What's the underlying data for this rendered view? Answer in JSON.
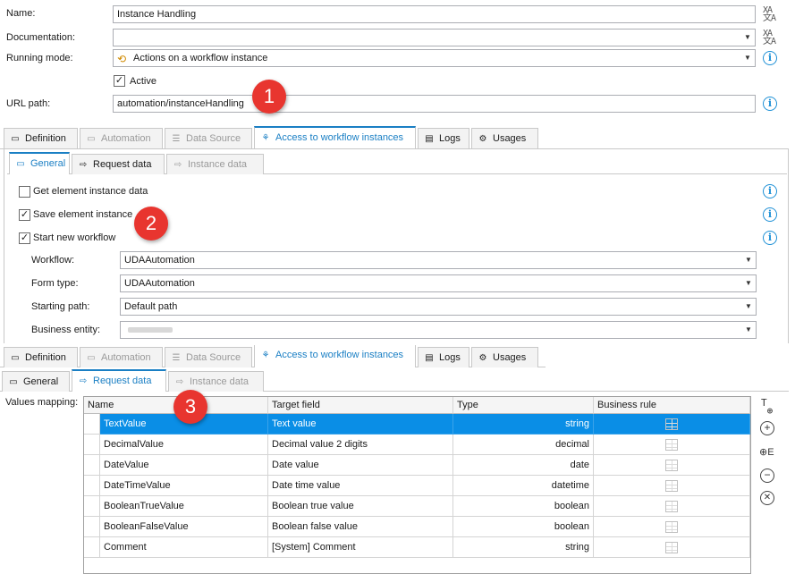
{
  "form": {
    "name_label": "Name:",
    "name_value": "Instance Handling",
    "documentation_label": "Documentation:",
    "documentation_value": "",
    "running_mode_label": "Running mode:",
    "running_mode_value": "Actions on a workflow instance",
    "active_label": "Active",
    "active_checked": true,
    "url_label": "URL path:",
    "url_value": "automation/instanceHandling"
  },
  "badges": [
    "1",
    "2",
    "3"
  ],
  "main_tabs": [
    {
      "label": "Definition",
      "icon": "window-icon",
      "state": "normal"
    },
    {
      "label": "Automation",
      "icon": "automation-icon",
      "state": "disabled"
    },
    {
      "label": "Data Source",
      "icon": "database-icon",
      "state": "disabled"
    },
    {
      "label": "Access to workflow instances",
      "icon": "workflow-icon",
      "state": "active"
    },
    {
      "label": "Logs",
      "icon": "logs-icon",
      "state": "normal"
    },
    {
      "label": "Usages",
      "icon": "usages-icon",
      "state": "normal"
    }
  ],
  "sub_tabs_top": [
    {
      "label": "General",
      "state": "active"
    },
    {
      "label": "Request data",
      "state": "normal"
    },
    {
      "label": "Instance data",
      "state": "disabled"
    }
  ],
  "general": {
    "get_instance_label": "Get element instance data",
    "save_instance_label": "Save element instance",
    "start_workflow_label": "Start new workflow",
    "workflow_label": "Workflow:",
    "workflow_value": "UDAAutomation",
    "form_type_label": "Form type:",
    "form_type_value": "UDAAutomation",
    "starting_path_label": "Starting path:",
    "starting_path_value": "Default path",
    "business_entity_label": "Business entity:",
    "business_entity_value": ""
  },
  "main_tabs_2": [
    {
      "label": "Definition",
      "state": "normal"
    },
    {
      "label": "Automation",
      "state": "disabled"
    },
    {
      "label": "Data Source",
      "state": "disabled"
    },
    {
      "label": "Access to workflow instances",
      "state": "active"
    },
    {
      "label": "Logs",
      "state": "normal"
    },
    {
      "label": "Usages",
      "state": "normal"
    }
  ],
  "sub_tabs_bottom": [
    {
      "label": "General",
      "state": "normal"
    },
    {
      "label": "Request data",
      "state": "active"
    },
    {
      "label": "Instance data",
      "state": "disabled"
    }
  ],
  "mapping": {
    "label": "Values mapping:",
    "columns": [
      "Name",
      "Target field",
      "Type",
      "Business rule"
    ],
    "rows": [
      {
        "name": "TextValue",
        "target": "Text value",
        "type": "string",
        "selected": true
      },
      {
        "name": "DecimalValue",
        "target": "Decimal value 2 digits",
        "type": "decimal",
        "selected": false
      },
      {
        "name": "DateValue",
        "target": "Date value",
        "type": "date",
        "selected": false
      },
      {
        "name": "DateTimeValue",
        "target": "Date time value",
        "type": "datetime",
        "selected": false
      },
      {
        "name": "BooleanTrueValue",
        "target": "Boolean true value",
        "type": "boolean",
        "selected": false
      },
      {
        "name": "BooleanFalseValue",
        "target": "Boolean false value",
        "type": "boolean",
        "selected": false
      },
      {
        "name": "Comment",
        "target": "[System] Comment",
        "type": "string",
        "selected": false
      }
    ]
  },
  "colors": {
    "accent": "#1a7fc4",
    "selection": "#0a8ee6",
    "badge": "#e8352f",
    "info": "#1e90d6"
  }
}
